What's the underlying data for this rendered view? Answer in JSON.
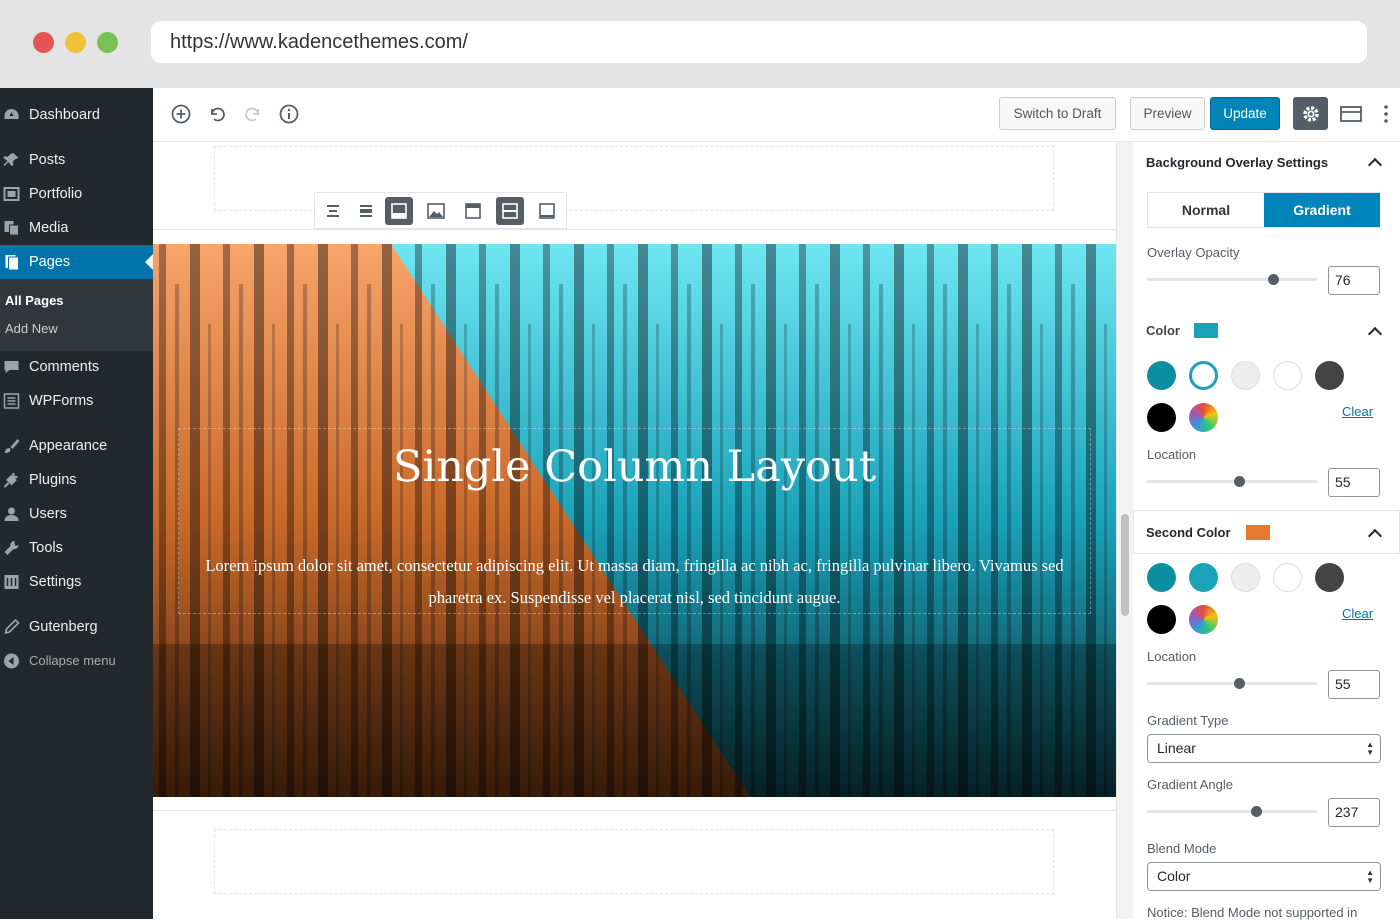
{
  "browser": {
    "url": "https://www.kadencethemes.com/"
  },
  "sidebar": {
    "items": [
      {
        "label": "Dashboard",
        "icon": "dashboard-icon"
      },
      {
        "label": "Posts",
        "icon": "pin-icon"
      },
      {
        "label": "Portfolio",
        "icon": "portfolio-icon"
      },
      {
        "label": "Media",
        "icon": "media-icon"
      },
      {
        "label": "Pages",
        "icon": "pages-icon",
        "active": true
      },
      {
        "label": "Comments",
        "icon": "comment-icon"
      },
      {
        "label": "WPForms",
        "icon": "forms-icon"
      },
      {
        "label": "Appearance",
        "icon": "brush-icon"
      },
      {
        "label": "Plugins",
        "icon": "plug-icon"
      },
      {
        "label": "Users",
        "icon": "user-icon"
      },
      {
        "label": "Tools",
        "icon": "wrench-icon"
      },
      {
        "label": "Settings",
        "icon": "settings-icon"
      },
      {
        "label": "Gutenberg",
        "icon": "pencil-icon"
      }
    ],
    "submenu": {
      "all_pages": "All Pages",
      "add_new": "Add New"
    },
    "collapse": "Collapse menu"
  },
  "toolbar": {
    "switch_to_draft": "Switch to Draft",
    "preview": "Preview",
    "update": "Update"
  },
  "hero": {
    "title": "Single Column Layout",
    "text": "Lorem ipsum dolor sit amet, consectetur adipiscing elit. Ut massa diam, fringilla ac nibh ac, fringilla pulvinar libero. Vivamus sed pharetra ex. Suspendisse vel placerat nisl, sed tincidunt augue.",
    "first_color": "#00a5b5",
    "second_color": "#e57a2e"
  },
  "inspector": {
    "panel_title": "Background Overlay Settings",
    "tabs": {
      "normal": "Normal",
      "gradient": "Gradient"
    },
    "overlay_opacity": {
      "label": "Overlay Opacity",
      "value": "76",
      "fraction": 0.76
    },
    "color": {
      "label": "Color",
      "value": "#1aa2b9"
    },
    "location1": {
      "label": "Location",
      "value": "55",
      "fraction": 0.55
    },
    "second_color": {
      "label": "Second Color",
      "value": "#e57a2e"
    },
    "location2": {
      "label": "Location",
      "value": "55",
      "fraction": 0.55
    },
    "gradient_type": {
      "label": "Gradient Type",
      "value": "Linear"
    },
    "gradient_angle": {
      "label": "Gradient Angle",
      "value": "237"
    },
    "blend_mode": {
      "label": "Blend Mode",
      "value": "Color"
    },
    "clear": "Clear",
    "palette": [
      "#0b8fa0",
      "#ffffff",
      "#eeeeee",
      "#ffffff",
      "#444444",
      "#000000",
      "multicolor"
    ],
    "notice": "Notice: Blend Mode not supported in"
  }
}
